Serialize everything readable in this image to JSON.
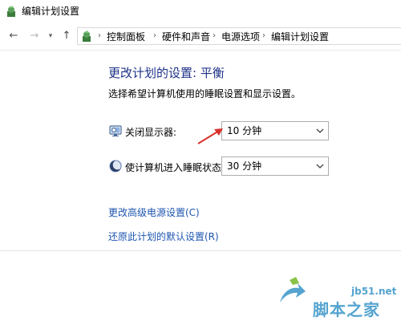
{
  "window": {
    "title": "编辑计划设置"
  },
  "nav": {
    "back_glyph": "←",
    "forward_glyph": "→",
    "recent_glyph": "▾",
    "up_glyph": "↑"
  },
  "breadcrumb": {
    "items": [
      "控制面板",
      "硬件和声音",
      "电源选项",
      "编辑计划设置"
    ]
  },
  "content": {
    "heading": "更改计划的设置: 平衡",
    "description": "选择希望计算机使用的睡眠设置和显示设置。",
    "display_off": {
      "label": "关闭显示器:",
      "value": "10 分钟",
      "icon": "monitor-icon"
    },
    "sleep": {
      "label": "使计算机进入睡眠状态:",
      "value": "30 分钟",
      "icon": "moon-icon"
    },
    "advanced_link": "更改高级电源设置(C)",
    "restore_link": "还原此计划的默认设置(R)"
  },
  "watermark": {
    "url": "jb51.net",
    "name": "脚本之家"
  },
  "colors": {
    "heading": "#1e3287",
    "link": "#1e55b0",
    "arrow": "#d9322b",
    "watermark": "#55a4cf"
  }
}
